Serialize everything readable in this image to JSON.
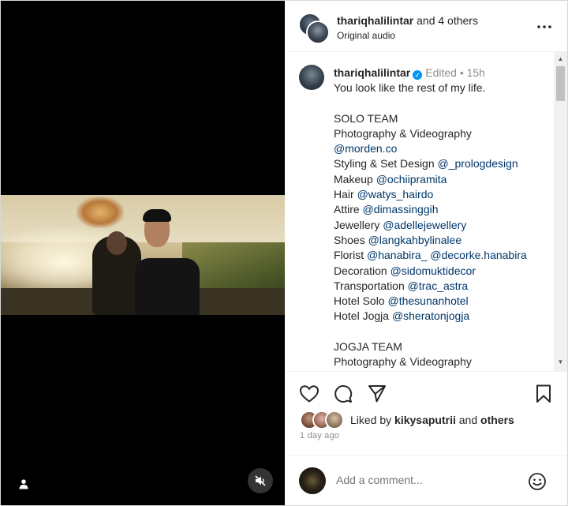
{
  "header": {
    "username": "thariqhalilintar",
    "others_text": " and 4 others",
    "subtitle": "Original audio"
  },
  "caption": {
    "username": "thariqhalilintar",
    "meta": "Edited • 15h",
    "lines": [
      {
        "plain": "You look like the rest of my life.",
        "mention": ""
      },
      {
        "plain": "",
        "mention": ""
      },
      {
        "plain": "SOLO TEAM",
        "mention": ""
      },
      {
        "plain": "Photography & Videography",
        "mention": ""
      },
      {
        "plain": "",
        "mention": "@morden.co"
      },
      {
        "plain": "Styling & Set Design ",
        "mention": "@_prologdesign"
      },
      {
        "plain": "Makeup ",
        "mention": "@ochiipramita"
      },
      {
        "plain": "Hair ",
        "mention": "@watys_hairdo"
      },
      {
        "plain": "Attire ",
        "mention": "@dimassinggih"
      },
      {
        "plain": "Jewellery ",
        "mention": "@adellejewellery"
      },
      {
        "plain": "Shoes ",
        "mention": "@langkahbylinalee"
      },
      {
        "plain": "Florist ",
        "mention": "@hanabira_ @decorke.hanabira"
      },
      {
        "plain": "Decoration ",
        "mention": "@sidomuktidecor"
      },
      {
        "plain": "Transportation ",
        "mention": "@trac_astra"
      },
      {
        "plain": "Hotel Solo ",
        "mention": "@thesunanhotel"
      },
      {
        "plain": "Hotel Jogja ",
        "mention": "@sheratonjogja"
      },
      {
        "plain": "",
        "mention": ""
      },
      {
        "plain": "JOGJA TEAM",
        "mention": ""
      },
      {
        "plain": "Photography & Videography",
        "mention": ""
      }
    ]
  },
  "likes": {
    "prefix": "Liked by ",
    "user": "kikysaputrii",
    "suffix": " and ",
    "others": "others"
  },
  "time_ago": "1 day ago",
  "comment": {
    "placeholder": "Add a comment..."
  },
  "icons": {
    "like": "heart-icon",
    "comment": "comment-icon",
    "share": "send-icon",
    "save": "bookmark-icon",
    "more": "more-icon",
    "emoji": "emoji-icon",
    "mute": "muted-speaker-icon",
    "tag": "user-tag-icon"
  },
  "colors": {
    "mention": "#00376b",
    "verified": "#0095f6",
    "muted_text": "#8e8e8e"
  }
}
